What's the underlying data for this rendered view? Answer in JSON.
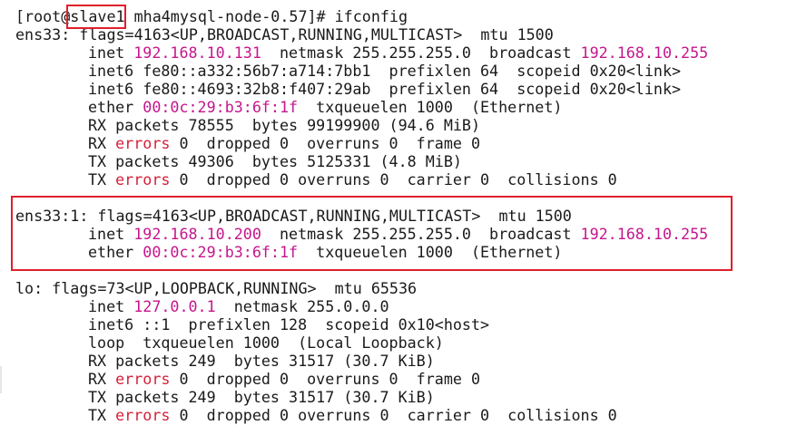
{
  "prompt": {
    "open": "[root@",
    "host": "slave1",
    "path": " mha4mysql-node-0.57]# ",
    "command": "ifconfig"
  },
  "colors": {
    "text": "#1a1a1a",
    "error_red": "#d4213a",
    "address_magenta": "#c5168c",
    "highlight_box": "#e0202c",
    "background": "#ffffff"
  },
  "ens33": {
    "header": "ens33: flags=4163<UP,BROADCAST,RUNNING,MULTICAST>  mtu 1500",
    "inet_label": "inet ",
    "inet": "192.168.10.131",
    "netmask": "  netmask 255.255.255.0  broadcast ",
    "broadcast": "192.168.10.255",
    "inet6_1": "inet6 fe80::a332:56b7:a714:7bb1  prefixlen 64  scopeid 0x20<link>",
    "inet6_2": "inet6 fe80::4693:32b8:f407:29ab  prefixlen 64  scopeid 0x20<link>",
    "ether_label": "ether ",
    "ether": "00:0c:29:b3:6f:1f",
    "ether_rest": "  txqueuelen 1000  (Ethernet)",
    "rx_packets": "RX packets 78555  bytes 99199900 (94.6 MiB)",
    "rx_errors_prefix": "RX ",
    "rx_errors_word": "errors",
    "rx_errors_rest": " 0  dropped 0  overruns 0  frame 0",
    "tx_packets": "TX packets 49306  bytes 5125331 (4.8 MiB)",
    "tx_errors_prefix": "TX ",
    "tx_errors_word": "errors",
    "tx_errors_rest": " 0  dropped 0 overruns 0  carrier 0  collisions 0"
  },
  "ens33_1": {
    "header": "ens33:1: flags=4163<UP,BROADCAST,RUNNING,MULTICAST>  mtu 1500",
    "inet_label": "inet ",
    "inet": "192.168.10.200",
    "netmask": "  netmask 255.255.255.0  broadcast ",
    "broadcast": "192.168.10.255",
    "ether_label": "ether ",
    "ether": "00:0c:29:b3:6f:1f",
    "ether_rest": "  txqueuelen 1000  (Ethernet)"
  },
  "lo": {
    "header": "lo: flags=73<UP,LOOPBACK,RUNNING>  mtu 65536",
    "inet_label": "inet ",
    "inet": "127.0.0.1",
    "netmask": "  netmask 255.0.0.0",
    "inet6": "inet6 ::1  prefixlen 128  scopeid 0x10<host>",
    "loop": "loop  txqueuelen 1000  (Local Loopback)",
    "rx_packets": "RX packets 249  bytes 31517 (30.7 KiB)",
    "rx_errors_prefix": "RX ",
    "rx_errors_word": "errors",
    "rx_errors_rest": " 0  dropped 0  overruns 0  frame 0",
    "tx_packets": "TX packets 249  bytes 31517 (30.7 KiB)",
    "tx_errors_prefix": "TX ",
    "tx_errors_word": "errors",
    "tx_errors_rest": " 0  dropped 0 overruns 0  carrier 0  collisions 0"
  }
}
